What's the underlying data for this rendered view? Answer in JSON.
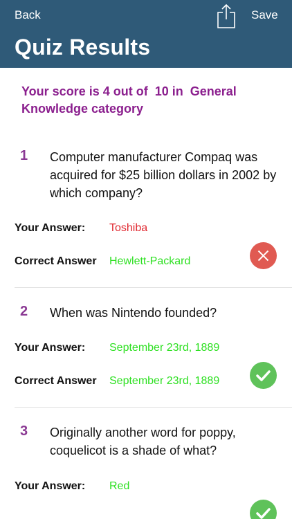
{
  "header": {
    "back_label": "Back",
    "save_label": "Save",
    "title": "Quiz Results"
  },
  "score_text": "Your score is 4 out of  10 in  General Knowledge category",
  "labels": {
    "your_answer": "Your Answer:",
    "correct_answer": "Correct Answer"
  },
  "questions": [
    {
      "number": "1",
      "text": "Computer manufacturer Compaq was acquired for $25 billion dollars in 2002 by which company?",
      "your_answer": "Toshiba",
      "correct_answer": "Hewlett-Packard",
      "result": "wrong"
    },
    {
      "number": "2",
      "text": "When was Nintendo founded?",
      "your_answer": "September 23rd, 1889",
      "correct_answer": "September 23rd, 1889",
      "result": "correct"
    },
    {
      "number": "3",
      "text": "Originally another word for poppy, coquelicot is a shade of what?",
      "your_answer": "Red",
      "correct_answer": "",
      "result": "correct"
    }
  ],
  "colors": {
    "header_bg": "#2f5a78",
    "score_text": "#8b1f8e",
    "wrong": "#e0262e",
    "correct": "#2ee022",
    "wrong_icon_bg": "#e05a52",
    "correct_icon_bg": "#5fc25a"
  }
}
